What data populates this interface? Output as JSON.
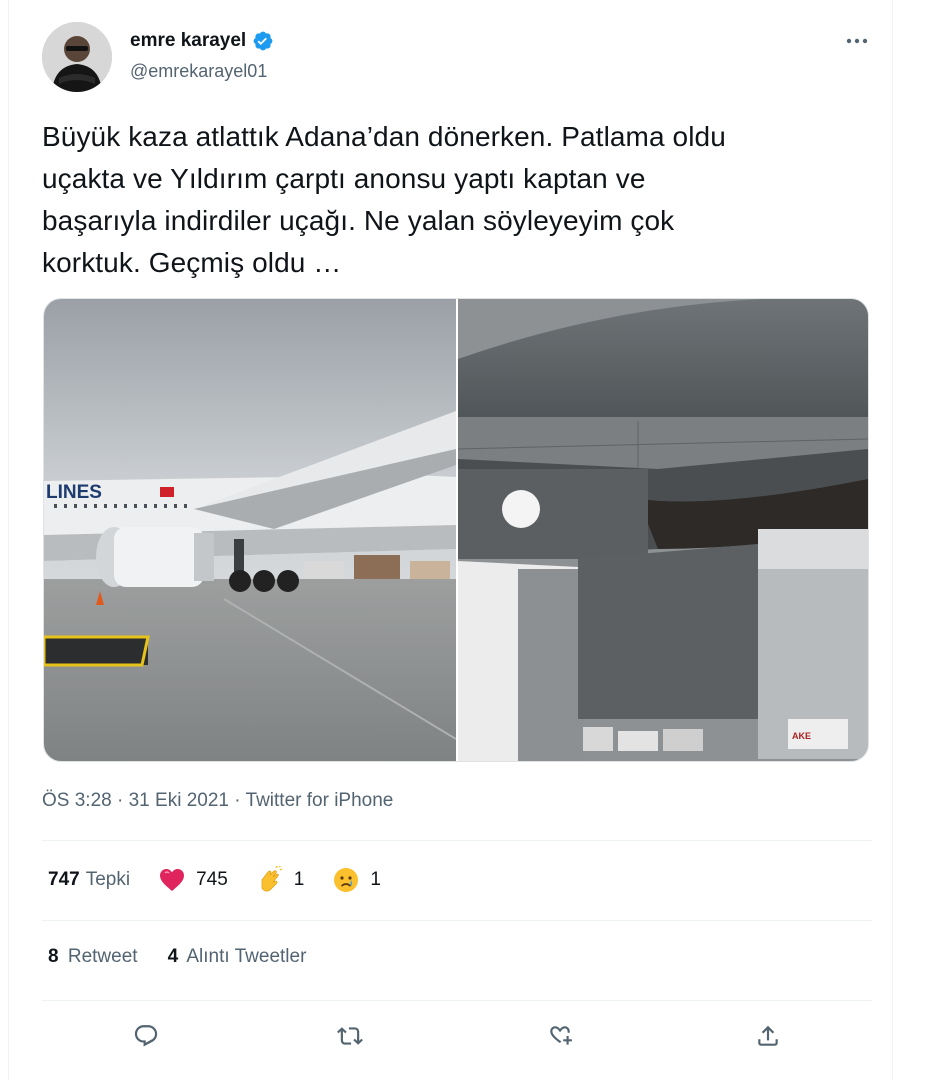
{
  "author": {
    "display_name": "emre karayel",
    "handle": "@emrekarayel01",
    "avatar_icon": "avatar-photo",
    "verified_icon": "verified-badge-icon",
    "verified_color": "#1d9bf0"
  },
  "more_icon": "more-horizontal-icon",
  "tweet": {
    "lines": [
      "Büyük kaza atlattık Adana’dan dönerken. Patlama oldu",
      "uçakta ve Yıldırım çarptı anonsu yaptı kaptan ve",
      "başarıyla indirdiler uçağı.  Ne yalan söyleyeyim çok",
      "korktuk. Geçmiş oldu …"
    ]
  },
  "media": {
    "photo_1_label": "LINES",
    "photo_2_label": "AKE"
  },
  "meta": {
    "time": "ÖS 3:28",
    "separator": "·",
    "date": "31 Eki 2021",
    "source": "Twitter for iPhone"
  },
  "reactions": {
    "total": "747",
    "total_label": "Tepki",
    "items": [
      {
        "icon": "heart-icon",
        "count": "745"
      },
      {
        "icon": "clap-icon",
        "count": "1"
      },
      {
        "icon": "sad-face-icon",
        "count": "1"
      }
    ],
    "heart_color": "#f91880"
  },
  "counts": {
    "retweets": "8",
    "retweets_label": "Retweet",
    "quotes": "4",
    "quotes_label": "Alıntı Tweetler"
  },
  "actions": [
    {
      "name": "reply-icon"
    },
    {
      "name": "retweet-icon"
    },
    {
      "name": "like-icon"
    },
    {
      "name": "share-icon"
    }
  ],
  "colors": {
    "text": "#0f1419",
    "secondary": "#536471",
    "divider": "#eff3f4"
  }
}
